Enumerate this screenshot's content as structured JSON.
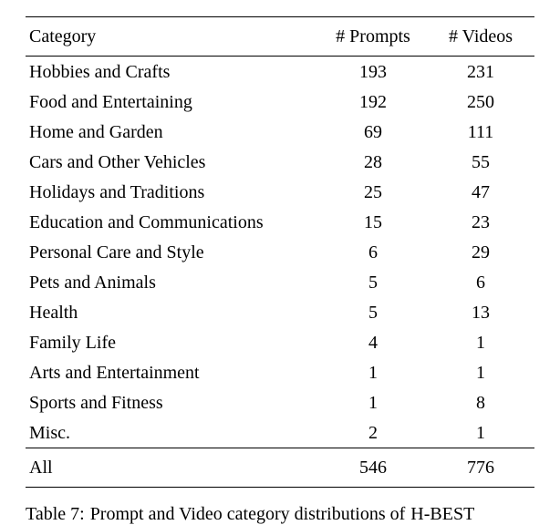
{
  "chart_data": {
    "type": "table",
    "columns": [
      "Category",
      "# Prompts",
      "# Videos"
    ],
    "rows": [
      {
        "category": "Hobbies and Crafts",
        "prompts": 193,
        "videos": 231
      },
      {
        "category": "Food and Entertaining",
        "prompts": 192,
        "videos": 250
      },
      {
        "category": "Home and Garden",
        "prompts": 69,
        "videos": 111
      },
      {
        "category": "Cars and Other Vehicles",
        "prompts": 28,
        "videos": 55
      },
      {
        "category": "Holidays and Traditions",
        "prompts": 25,
        "videos": 47
      },
      {
        "category": "Education and Communications",
        "prompts": 15,
        "videos": 23
      },
      {
        "category": "Personal Care and Style",
        "prompts": 6,
        "videos": 29
      },
      {
        "category": "Pets and Animals",
        "prompts": 5,
        "videos": 6
      },
      {
        "category": "Health",
        "prompts": 5,
        "videos": 13
      },
      {
        "category": "Family Life",
        "prompts": 4,
        "videos": 1
      },
      {
        "category": "Arts and Entertainment",
        "prompts": 1,
        "videos": 1
      },
      {
        "category": "Sports and Fitness",
        "prompts": 1,
        "videos": 8
      },
      {
        "category": "Misc.",
        "prompts": 2,
        "videos": 1
      }
    ],
    "total": {
      "category": "All",
      "prompts": 546,
      "videos": 776
    }
  },
  "headers": {
    "category": "Category",
    "prompts": "# Prompts",
    "videos": "# Videos"
  },
  "caption": {
    "lead": "Table 7:",
    "text": "Prompt and Video category distributions of",
    "tail": "H-BEST"
  }
}
